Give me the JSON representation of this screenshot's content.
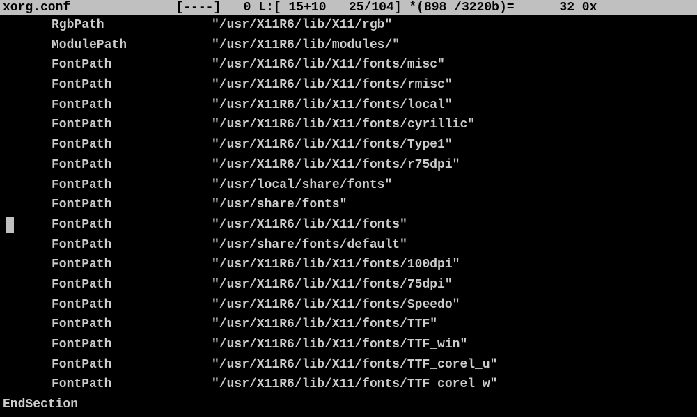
{
  "status": {
    "filename": "xorg.conf",
    "flags": "[----]",
    "col": "0",
    "line_info": "L:[ 15+10   25/104]",
    "misc": "*(898 /3220b)=",
    "tail": "32 0x"
  },
  "lines": [
    {
      "key": "RgbPath",
      "value": "\"/usr/X11R6/lib/X11/rgb\"",
      "cursor": false
    },
    {
      "key": "ModulePath",
      "value": "\"/usr/X11R6/lib/modules/\"",
      "cursor": false
    },
    {
      "key": "FontPath",
      "value": "\"/usr/X11R6/lib/X11/fonts/misc\"",
      "cursor": false
    },
    {
      "key": "FontPath",
      "value": "\"/usr/X11R6/lib/X11/fonts/rmisc\"",
      "cursor": false
    },
    {
      "key": "FontPath",
      "value": "\"/usr/X11R6/lib/X11/fonts/local\"",
      "cursor": false
    },
    {
      "key": "FontPath",
      "value": "\"/usr/X11R6/lib/X11/fonts/cyrillic\"",
      "cursor": false
    },
    {
      "key": "FontPath",
      "value": "\"/usr/X11R6/lib/X11/fonts/Type1\"",
      "cursor": false
    },
    {
      "key": "FontPath",
      "value": "\"/usr/X11R6/lib/X11/fonts/r75dpi\"",
      "cursor": false
    },
    {
      "key": "FontPath",
      "value": "\"/usr/local/share/fonts\"",
      "cursor": false
    },
    {
      "key": "FontPath",
      "value": "\"/usr/share/fonts\"",
      "cursor": false
    },
    {
      "key": "FontPath",
      "value": "\"/usr/X11R6/lib/X11/fonts\"",
      "cursor": true
    },
    {
      "key": "FontPath",
      "value": "\"/usr/share/fonts/default\"",
      "cursor": false
    },
    {
      "key": "FontPath",
      "value": "\"/usr/X11R6/lib/X11/fonts/100dpi\"",
      "cursor": false
    },
    {
      "key": "FontPath",
      "value": "\"/usr/X11R6/lib/X11/fonts/75dpi\"",
      "cursor": false
    },
    {
      "key": "FontPath",
      "value": "\"/usr/X11R6/lib/X11/fonts/Speedo\"",
      "cursor": false
    },
    {
      "key": "FontPath",
      "value": "\"/usr/X11R6/lib/X11/fonts/TTF\"",
      "cursor": false
    },
    {
      "key": "FontPath",
      "value": "\"/usr/X11R6/lib/X11/fonts/TTF_win\"",
      "cursor": false
    },
    {
      "key": "FontPath",
      "value": "\"/usr/X11R6/lib/X11/fonts/TTF_corel_u\"",
      "cursor": false
    },
    {
      "key": "FontPath",
      "value": "\"/usr/X11R6/lib/X11/fonts/TTF_corel_w\"",
      "cursor": false
    }
  ],
  "end_section": "EndSection"
}
